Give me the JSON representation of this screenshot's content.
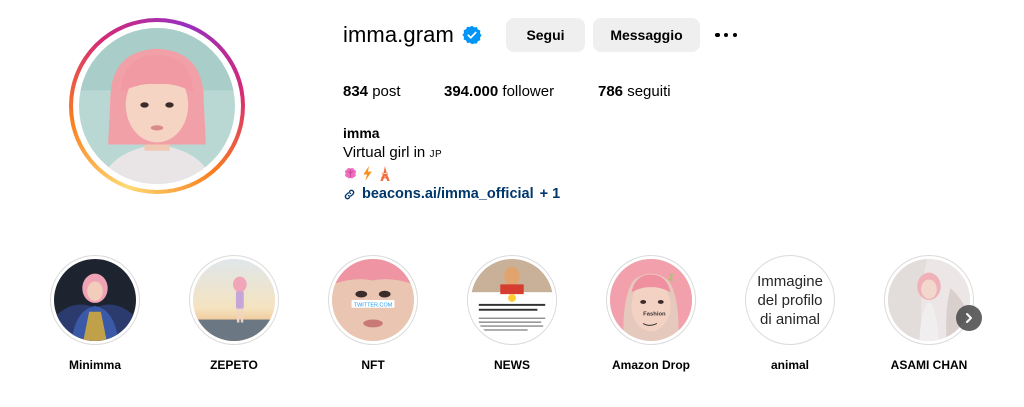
{
  "profile": {
    "username": "imma.gram",
    "verified_icon": "verified-badge-icon",
    "follow_label": "Segui",
    "message_label": "Messaggio",
    "more_icon": "more-options-icon"
  },
  "stats": {
    "posts_count": "834",
    "posts_label": "post",
    "followers_count": "394.000",
    "followers_label": "follower",
    "following_count": "786",
    "following_label": "seguiti"
  },
  "bio": {
    "name": "imma",
    "text": "Virtual girl in ",
    "flag_text": "JP",
    "emojis": [
      "brain-emoji",
      "lightning-emoji",
      "tokyo-tower-emoji"
    ],
    "link_icon": "link-icon",
    "link_text": "beacons.ai/imma_official",
    "link_extra": "+ 1"
  },
  "highlights": [
    {
      "label": "Minimma"
    },
    {
      "label": "ZEPETO"
    },
    {
      "label": "NFT",
      "image_text": "TWITTER.COM"
    },
    {
      "label": "NEWS"
    },
    {
      "label": "Amazon Drop",
      "image_text": "Fashion"
    },
    {
      "label": "animal",
      "alt_text": "Immagine del profilo di animal"
    },
    {
      "label": "ASAMI CHAN"
    }
  ],
  "colors": {
    "accent_link": "#00376b",
    "verified_blue": "#0095f6",
    "button_bg": "#efefef",
    "hair_pink": "#f2a0a8"
  },
  "nav": {
    "next_icon": "chevron-right-icon"
  }
}
